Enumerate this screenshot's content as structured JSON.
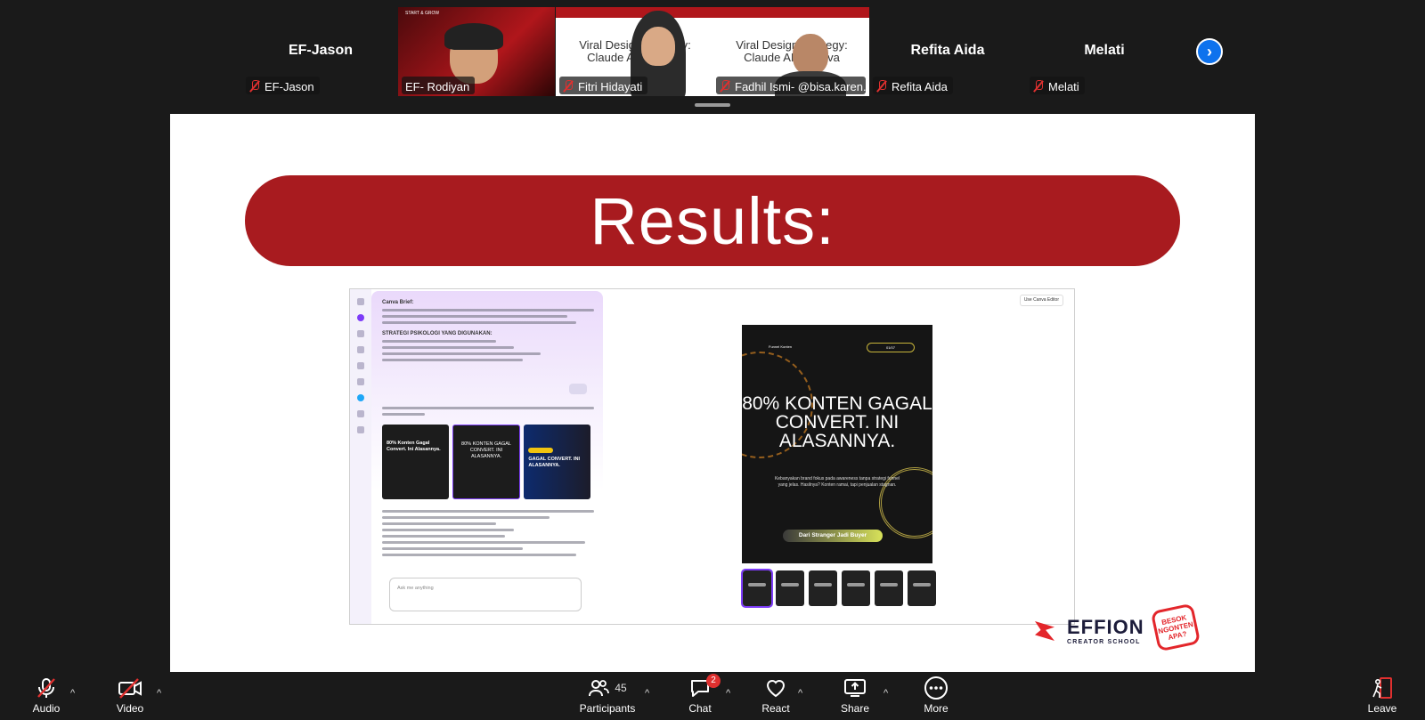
{
  "strip": {
    "tiles": [
      {
        "name": "EF-Jason",
        "tag": "EF-Jason",
        "muted": true,
        "video": false
      },
      {
        "name": "",
        "tag": "EF- Rodiyan",
        "muted": false,
        "video": true,
        "speaking": true
      },
      {
        "name": "",
        "tag": "Fitri Hidayati",
        "muted": true,
        "video": true
      },
      {
        "name": "",
        "tag": "Fadhil Ismi- @bisa.karen...",
        "muted": true,
        "video": true
      },
      {
        "name": "Refita Aida",
        "tag": "Refita Aida",
        "muted": true,
        "video": false
      },
      {
        "name": "Melati",
        "tag": "Melati",
        "muted": true,
        "video": false
      }
    ],
    "thumb_text_1": "Viral Design Strategy: Claude AI x Canva",
    "thumb_text_2": "Viral Design Strategy: Claude AI x Canva",
    "thumb_text_0": "START & GROW",
    "next_icon": "chevron-right-icon"
  },
  "slide": {
    "title": "Results:",
    "canva_chat": {
      "heading": "Canva Brief:",
      "heading2": "STRATEGI PSIKOLOGI YANG DIGUNAKAN:",
      "cards": [
        {
          "title": "80% Konten Gagal Convert. Ini Alasannya."
        },
        {
          "title": "80% KONTEN GAGAL CONVERT. INI ALASANNYA."
        },
        {
          "title": "GAGAL CONVERT. INI ALASANNYA."
        }
      ],
      "input_placeholder": "Ask me anything"
    },
    "canva_preview": {
      "use_editor": "Use Canva Editor",
      "brand": "Funnel Konten",
      "chip": "01/07",
      "headline": "80% KONTEN GAGAL CONVERT. INI ALASANNYA.",
      "subtext": "Kebanyakan brand fokus pada awareness tanpa strategi funnel yang jelas. Hasilnya? Konten ramai, tapi penjualan stagnan.",
      "cta": "Dari Stranger Jadi Buyer"
    },
    "logo": {
      "name": "EFFION",
      "tagline": "CREATOR SCHOOL"
    },
    "badge": [
      "BESOK",
      "NGONTEN",
      "APA?"
    ]
  },
  "toolbar": {
    "audio": "Audio",
    "video": "Video",
    "participants": "Participants",
    "participants_count": "45",
    "chat": "Chat",
    "chat_badge": "2",
    "react": "React",
    "share": "Share",
    "more": "More",
    "leave": "Leave"
  },
  "colors": {
    "accent": "#0e72ed",
    "slide_red": "#a81b1f",
    "muted_red": "#e0302f",
    "speaking_green": "#23d160"
  }
}
